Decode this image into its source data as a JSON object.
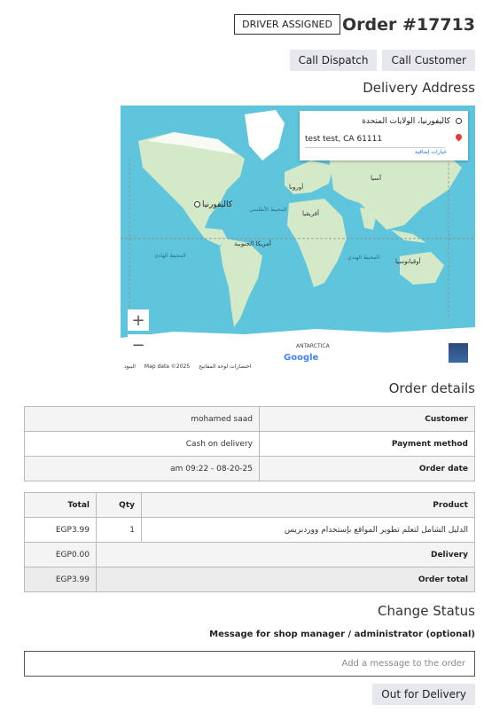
{
  "order": {
    "badge": "DRIVER ASSIGNED",
    "title": "Order #17713"
  },
  "actions": {
    "call_dispatch": "Call Dispatch",
    "call_customer": "Call Customer"
  },
  "delivery": {
    "heading": "Delivery Address"
  },
  "map": {
    "from": "كاليفورنيا، الولايات المتحدة",
    "to": "test test, CA 61111",
    "more_options": "خيارات إضافية",
    "pin_label": "كاليفورنيا",
    "labels": {
      "europe": "أوروبا",
      "asia": "آسيا",
      "africa": "أفريقيا",
      "south_america": "أمريكا الجنوبية",
      "australia": "أوقيانوسيا",
      "atlantic": "المحيط الأطلسي",
      "indian": "المحيط الهندي",
      "pacific": "المحيط الهادئ"
    },
    "antarctica": "ANTARCTICA",
    "google": "Google",
    "map_data": "Map data ©2025",
    "shortcuts": "اختصارات لوحة المفاتيح",
    "terms": "البنود",
    "zoom_in": "+",
    "zoom_out": "−",
    "colors": {
      "water": "#5fc5dc",
      "land": "#d4e9c8",
      "ice": "#ffffff"
    }
  },
  "details": {
    "heading": "Order details",
    "rows": [
      {
        "label": "Customer",
        "value": "mohamed saad"
      },
      {
        "label": "Payment method",
        "value": "Cash on delivery"
      },
      {
        "label": "Order date",
        "value": "am 09:22 - 08-20-25"
      }
    ]
  },
  "items": {
    "headers": {
      "product": "Product",
      "qty": "Qty",
      "total": "Total"
    },
    "rows": [
      {
        "product": "الدليل الشامل لتعلم تطوير المواقع بإستخدام ووردبريس",
        "qty": "1",
        "total": "EGP3.99"
      }
    ],
    "delivery_label": "Delivery",
    "delivery_value": "EGP0.00",
    "total_label": "Order total",
    "total_value": "EGP3.99"
  },
  "status": {
    "heading": "Change Status",
    "message_label": "Message for shop manager / administrator (optional)",
    "message_value": "",
    "message_placeholder": "Add a message to the order",
    "button": "Out for Delivery"
  }
}
